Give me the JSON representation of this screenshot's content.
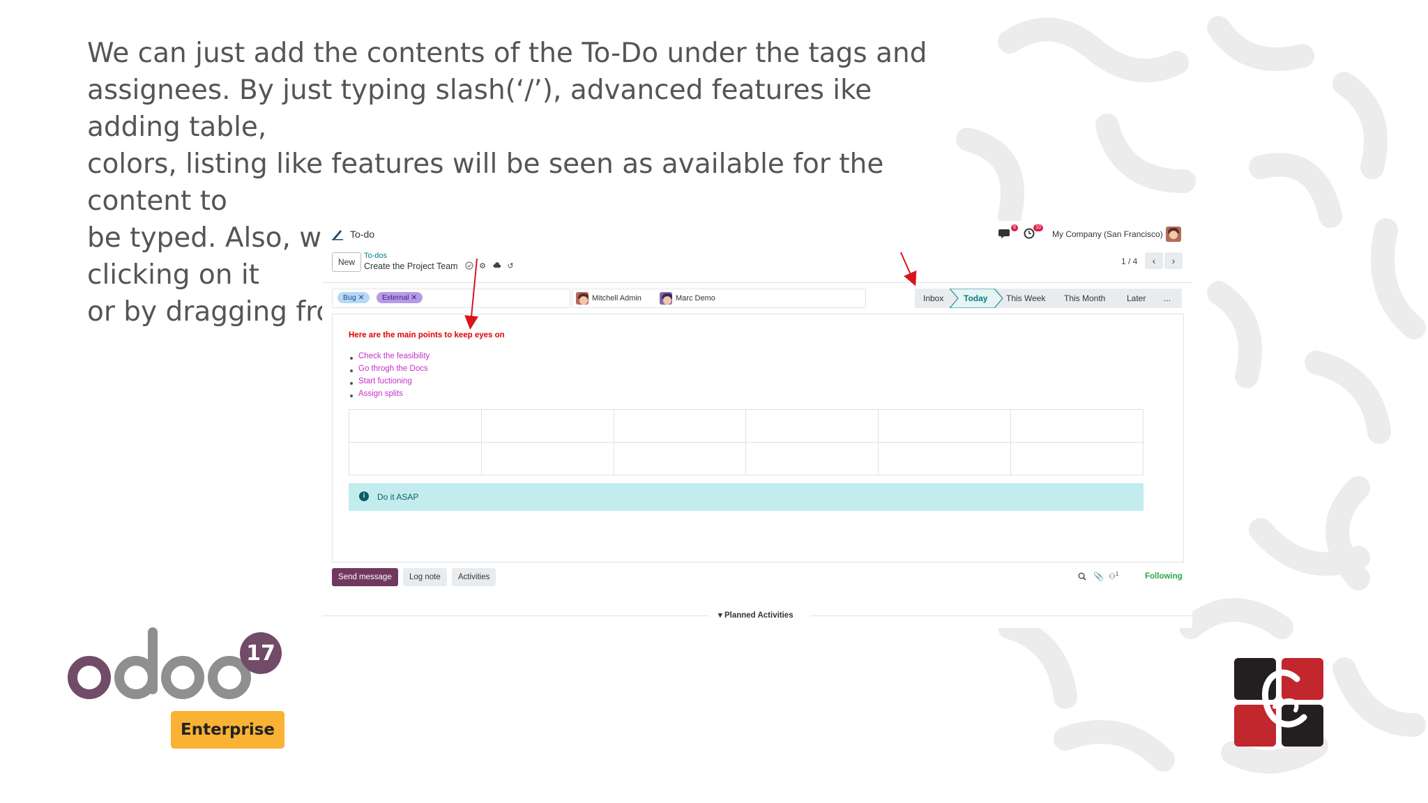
{
  "caption": "We can just add the contents of the To-Do under the tags and\nassignees. By just typing slash(‘/’), advanced features ike adding table,\ncolors, listing like features will be seen as available for the content to\nbe typed. Also, we can change the stage of the To-Do by clicking on it\nor by dragging from the kanban view.",
  "app": {
    "title": "To-do",
    "company": "My Company (San Francisco)",
    "messages_badge": "6",
    "activities_badge": "10"
  },
  "control_panel": {
    "new_label": "New",
    "breadcrumb_parent": "To-dos",
    "record_title": "Create the Project Team",
    "pager": "1 / 4"
  },
  "tags": [
    "Bug",
    "External"
  ],
  "assignees": [
    "Mitchell Admin",
    "Marc Demo"
  ],
  "stages": {
    "items": [
      "Inbox",
      "Today",
      "This Week",
      "This Month",
      "Later",
      "..."
    ],
    "active": "Today"
  },
  "content": {
    "heading": "Here are the main points to keep eyes on",
    "list": [
      "Check the feasibility",
      "Go throgh the Docs",
      "Start fuctioning",
      "Assign splits"
    ],
    "table": {
      "rows": 2,
      "cols": 6
    },
    "alert": "Do it ASAP"
  },
  "chatter": {
    "send_message": "Send message",
    "log_note": "Log note",
    "activities": "Activities",
    "followers_count": "1",
    "following": "Following",
    "planned_activities": "Planned Activities"
  },
  "branding": {
    "version": "17",
    "edition": "Enterprise",
    "colors": {
      "odoo_purple": "#714b67",
      "odoo_gray": "#8f8f8f",
      "enterprise_yellow": "#f9b233",
      "logo_red": "#c1272d",
      "logo_dark": "#231f20"
    }
  }
}
